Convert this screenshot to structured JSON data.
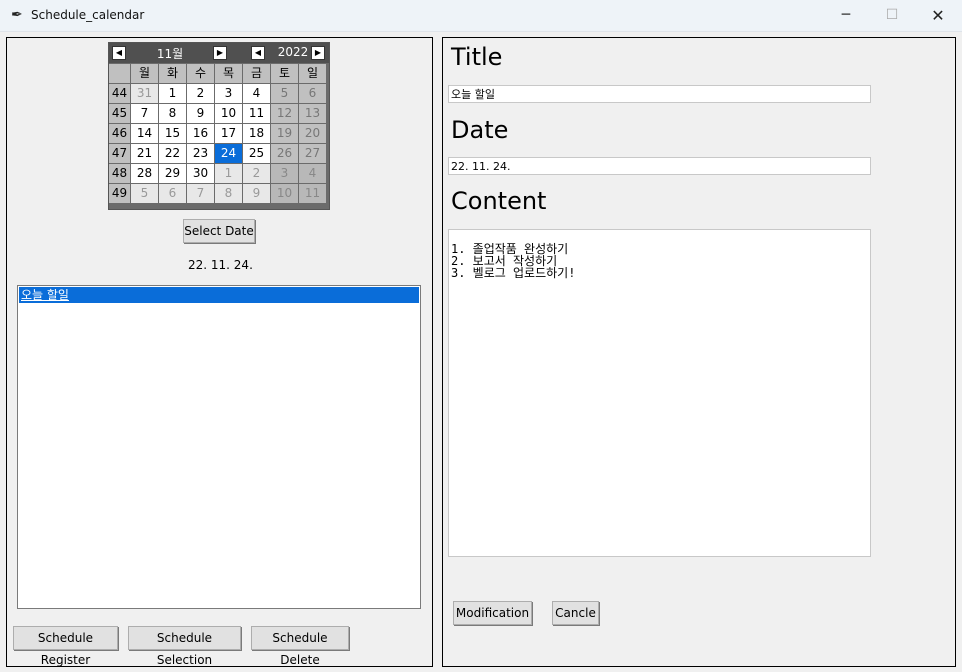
{
  "window": {
    "title": "Schedule_calendar",
    "minimize": "─",
    "maximize": "☐",
    "close": "✕"
  },
  "calendar": {
    "prev_month": "◀",
    "next_month": "▶",
    "prev_year": "◀",
    "next_year": "▶",
    "month": "11월",
    "year": "2022",
    "weekdays": [
      "월",
      "화",
      "수",
      "목",
      "금",
      "토",
      "일"
    ],
    "weeks": [
      {
        "num": "44",
        "days": [
          "31",
          "1",
          "2",
          "3",
          "4",
          "5",
          "6"
        ]
      },
      {
        "num": "45",
        "days": [
          "7",
          "8",
          "9",
          "10",
          "11",
          "12",
          "13"
        ]
      },
      {
        "num": "46",
        "days": [
          "14",
          "15",
          "16",
          "17",
          "18",
          "19",
          "20"
        ]
      },
      {
        "num": "47",
        "days": [
          "21",
          "22",
          "23",
          "24",
          "25",
          "26",
          "27"
        ]
      },
      {
        "num": "48",
        "days": [
          "28",
          "29",
          "30",
          "1",
          "2",
          "3",
          "4"
        ]
      },
      {
        "num": "49",
        "days": [
          "5",
          "6",
          "7",
          "8",
          "9",
          "10",
          "11"
        ]
      }
    ],
    "selected_day": "24"
  },
  "left": {
    "select_date_button": "Select Date",
    "selected_date_label": "22. 11. 24.",
    "schedule_list": [
      "오늘 할일"
    ],
    "register_button": "Schedule Register",
    "selection_button": "Schedule Selection",
    "delete_button": "Schedule Delete"
  },
  "right": {
    "title_label": "Title",
    "title_value": "오늘 할일",
    "date_label": "Date",
    "date_value": "22. 11. 24.",
    "content_label": "Content",
    "content_value": "1. 졸업작품 완성하기\n2. 보고서 작성하기\n3. 벨로그 업로드하기!",
    "modification_button": "Modification",
    "cancel_button": "Cancle"
  }
}
